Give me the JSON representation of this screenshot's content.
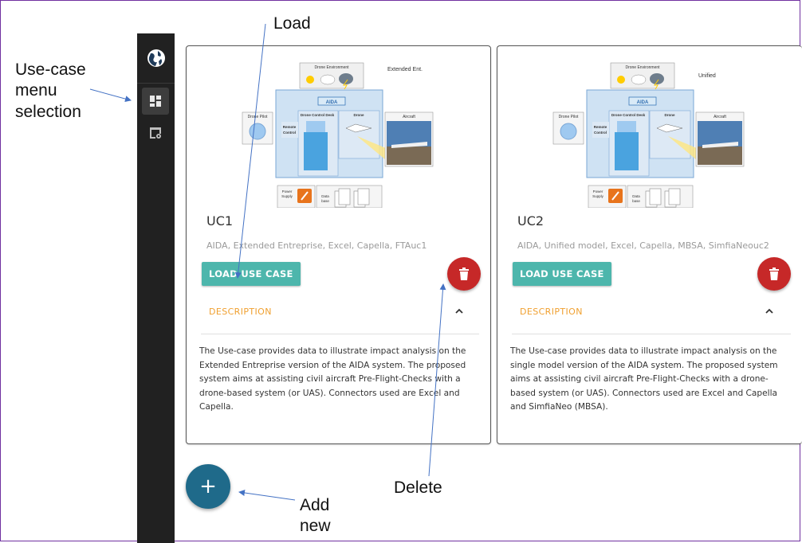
{
  "annotations": {
    "load": "Load",
    "menu_selection": "Use-case\nmenu\nselection",
    "delete": "Delete",
    "add_new": "Add\nnew"
  },
  "sidebar": {
    "items": [
      {
        "icon": "dashboard-icon",
        "active": true
      },
      {
        "icon": "window-settings-icon",
        "active": false
      }
    ]
  },
  "diagram_labels": {
    "drone_environment": "Drone Environment",
    "drone_pilot": "Drone Pilot",
    "drone_control_desk": "Drone Control Desk",
    "drone": "Drone",
    "aircraft": "Aircraft",
    "remote_control": "Remote Control",
    "power_supply": "Power Supply",
    "data_base": "Data base",
    "aida": "AIDA"
  },
  "cards": [
    {
      "variant": "Extended Ent.",
      "title": "UC1",
      "tags": "AIDA, Extended Entreprise, Excel, Capella, FTAuc1",
      "load_label": "LOAD USE CASE",
      "description_label": "DESCRIPTION",
      "description": "The Use-case provides data to illustrate impact analysis on the Extended Entreprise version of the AIDA system. The proposed system aims at assisting civil aircraft Pre-Flight-Checks with a drone-based system (or UAS). Connectors used are Excel and Capella."
    },
    {
      "variant": "Unified",
      "title": "UC2",
      "tags": "AIDA, Unified model, Excel, Capella, MBSA, SimfiaNeouc2",
      "load_label": "LOAD USE CASE",
      "description_label": "DESCRIPTION",
      "description": "The Use-case provides data to illustrate impact analysis on the single model version of the AIDA system. The proposed system aims at assisting civil aircraft Pre-Flight-Checks with a drone-based system (or UAS). Connectors used are Excel and Capella and SimfiaNeo (MBSA)."
    }
  ],
  "fab_label": "+",
  "colors": {
    "sidebar": "#212121",
    "load_button": "#4db6ac",
    "delete_button": "#c62828",
    "description_header": "#f0a030",
    "fab": "#1f6a8a"
  }
}
